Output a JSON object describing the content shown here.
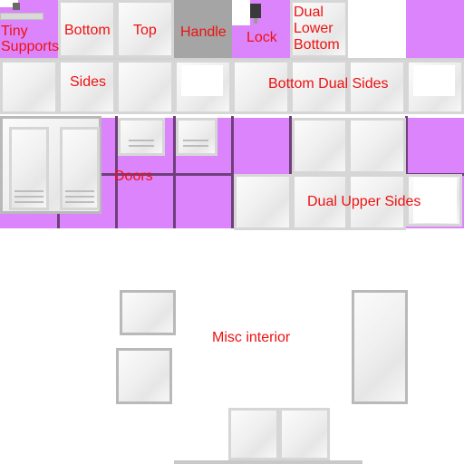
{
  "labels": {
    "tiny_supports": "Tiny\nSupports",
    "bottom": "Bottom",
    "top": "Top",
    "handle": "Handle",
    "lock": "Lock",
    "dual_lower_bottom": "Dual\nLower\nBottom",
    "sides": "Sides",
    "bottom_dual_sides": "Bottom Dual Sides",
    "doors": "Doors",
    "dual_upper_sides": "Dual Upper Sides",
    "misc_interior": "Misc interior"
  },
  "colors": {
    "purple": "#dc84fb",
    "handle_gray": "#a5a5a5",
    "label_red": "#ee1111",
    "divider": "#6f3f7a"
  }
}
